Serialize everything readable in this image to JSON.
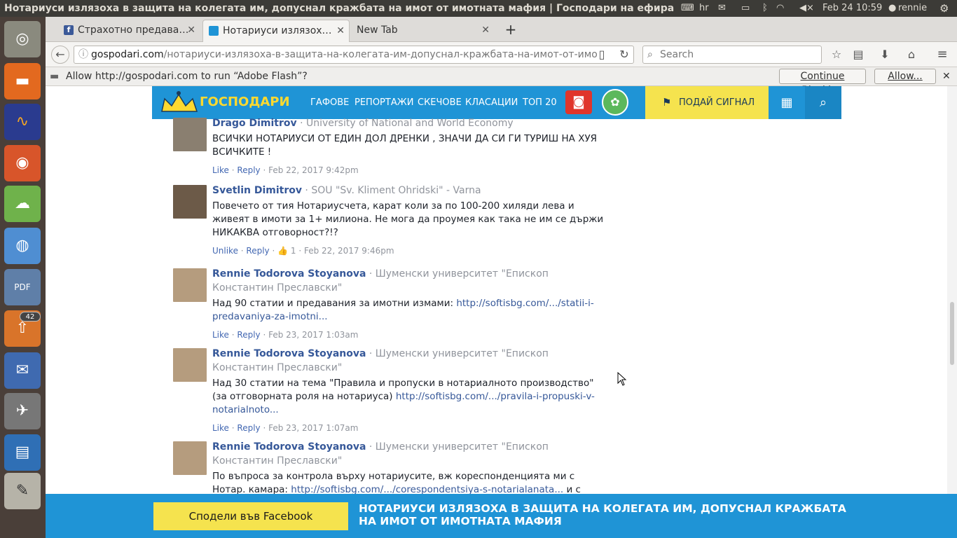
{
  "system": {
    "window_title": "Нотариуси излязоха в защита на колегата им, допуснал кражбата на имот от имотната мафия | Господари на ефира - Mozilla Firefox",
    "keyboard_layout": "hr",
    "clock": "Feb 24 10:59",
    "user": "rennie"
  },
  "launcher": {
    "badge_count": "42",
    "apps": [
      "ubuntu-logo-icon",
      "files-icon",
      "audacity-icon",
      "firefox-icon",
      "backup-icon",
      "chromium-icon",
      "pdf-editor-icon",
      "update-icon",
      "thunderbird-icon",
      "launcher-icon",
      "writer-icon",
      "text-editor-icon"
    ]
  },
  "tabs": [
    {
      "label": "Страхотно предава…",
      "active": false,
      "favicon": "facebook-icon"
    },
    {
      "label": "Нотариуси излязох…",
      "active": true,
      "favicon": "gospodari-icon"
    },
    {
      "label": "New Tab",
      "active": false
    }
  ],
  "nav": {
    "url_domain": "gospodari.com",
    "url_path": "/нотариуси-излязоха-в-защита-на-колегата-им-допуснал-кражбата-на-имот-от-имо",
    "search_placeholder": "Search"
  },
  "flash": {
    "message": "Allow http://gospodari.com to run “Adobe Flash”?",
    "continue_label": "Continue Blocking",
    "allow_label": "Allow..."
  },
  "site": {
    "logo_text": "ГОСПОДАРИ",
    "menu": [
      "ГАФОВЕ",
      "РЕПОРТАЖИ",
      "СКЕЧОВЕ",
      "КЛАСАЦИИ",
      "ТОП 20"
    ],
    "signal_label": "ПОДАЙ СИГНАЛ"
  },
  "comments": [
    {
      "name": "Drago Dimitrov",
      "affiliation": " · University of National and World Economy",
      "text": "ВСИЧКИ НОТАРИУСИ ОТ ЕДИН ДОЛ ДРЕНКИ , ЗНАЧИ ДА СИ ГИ ТУРИШ НА ХУЯ ВСИЧКИТЕ !",
      "link": "",
      "text_after": "",
      "like": "Like",
      "reply": "Reply",
      "likes": "",
      "date": "Feb 22, 2017 9:42pm"
    },
    {
      "name": "Svetlin Dimitrov",
      "affiliation": " · SOU \"Sv. Kliment Ohridski\" - Varna",
      "text": "Повечето от тия Нотариусчета, карат коли за по 100-200 хиляди лева и живеят в имоти за 1+ милиона. Не мога да проумея как така не им се държи НИКАКВА отговорност?!?",
      "link": "",
      "text_after": "",
      "like": "Unlike",
      "reply": "Reply",
      "likes": "1",
      "date": "Feb 22, 2017 9:46pm"
    },
    {
      "name": "Rennie Todorova Stoyanova",
      "affiliation": " · Шуменски университет \"Епископ Константин Преславски\"",
      "text": "Над 90 статии и предавания за имотни измами: ",
      "link": "http://softisbg.com/.../statii-i-predavaniya-za-imotni...",
      "text_after": "",
      "like": "Like",
      "reply": "Reply",
      "likes": "",
      "date": "Feb 23, 2017 1:03am"
    },
    {
      "name": "Rennie Todorova Stoyanova",
      "affiliation": " · Шуменски университет \"Епископ Константин Преславски\"",
      "text": "Над 30 статии на тема \"Правила и пропуски в нотариалното производство\" (за отговорната роля на нотариуса) ",
      "link": "http://softisbg.com/.../pravila-i-propuski-v-notarialnoto...",
      "text_after": "",
      "like": "Like",
      "reply": "Reply",
      "likes": "",
      "date": "Feb 23, 2017 1:07am"
    },
    {
      "name": "Rennie Todorova Stoyanova",
      "affiliation": " · Шуменски университет \"Епископ Константин Преславски\"",
      "text": "По въпроса за контрола върху нотариусите, вж кореспонденцията ми с Нотар. камара: ",
      "link": "http://softisbg.com/.../corespondentsiya-s-notarialanata...",
      "text_after": " и с Мин. на",
      "like": "",
      "reply": "",
      "likes": "",
      "date": ""
    }
  ],
  "share": {
    "button_label": "Сподели във Facebook",
    "title": "НОТАРИУСИ ИЗЛЯЗОХА В ЗАЩИТА НА КОЛЕГАТА ИМ, ДОПУСНАЛ КРАЖБАТА НА ИМОТ ОТ ИМОТНАТА МАФИЯ"
  },
  "colors": {
    "site_blue": "#1f94d6",
    "signal_yellow": "#f5e34e",
    "fb_link": "#365899"
  }
}
